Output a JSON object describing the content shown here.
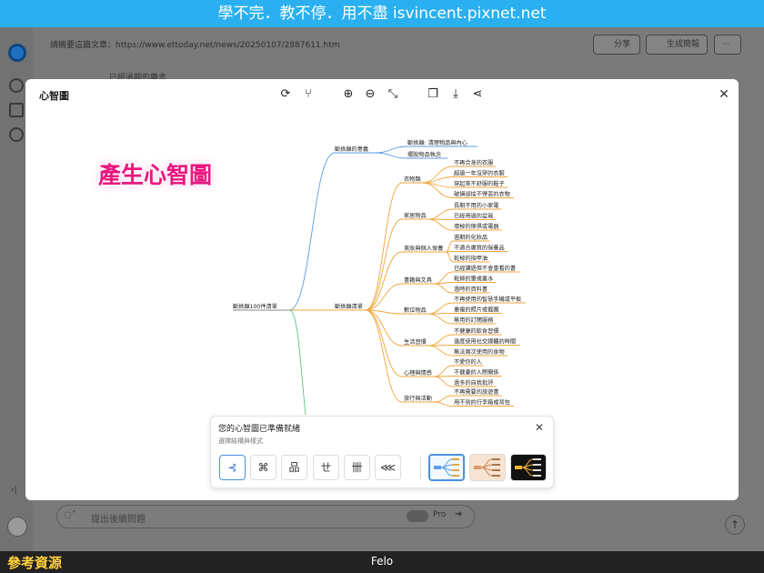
{
  "banner": {
    "text": "學不完．教不停．用不盡 isvincent.pixnet.net"
  },
  "background": {
    "url_label": "請摘要這篇文章：https://www.ettoday.net/news/20250107/2887611.htm",
    "share_label": "分享",
    "generate_label": "生成簡報",
    "more_label": "···",
    "under_text": "已經過期的藥盒",
    "chat_placeholder": "提出後續問題",
    "pro_label": "Pro",
    "send_icon": "arrow-right-icon"
  },
  "modal": {
    "title": "心智圖",
    "toolbar_icons": [
      "refresh-icon",
      "branch-icon",
      "zoom-in-icon",
      "zoom-out-icon",
      "fit-screen-icon",
      "copy-icon",
      "download-icon",
      "share-icon"
    ]
  },
  "overlay": {
    "text": "產生心智圖"
  },
  "mindmap": {
    "root": "斷捨離100件清單",
    "branches": [
      {
        "label": "斷捨離的意義",
        "children": [
          {
            "label": "斷捨離: 清理物品與內心",
            "children": []
          },
          {
            "label": "擺脫物品執念",
            "children": []
          }
        ]
      },
      {
        "label": "斷捨離清單",
        "children": [
          {
            "label": "衣物類",
            "children": [
              "不再合身的衣服",
              "超過一年沒穿的衣服",
              "穿起來不舒服的鞋子",
              "破損卻捨不得丟的衣物"
            ]
          },
          {
            "label": "家居物品",
            "children": [
              "長期不用的小家電",
              "已經用過的盆栽",
              "壞掉的傢俱或電器"
            ]
          },
          {
            "label": "美妝與個人保養",
            "children": [
              "過期的化妝品",
              "不適合膚質的保養品",
              "乾掉的指甲油"
            ]
          },
          {
            "label": "書籍與文具",
            "children": [
              "已經讀過但不會重看的書",
              "乾掉的筆或墨水",
              "過時的資料書"
            ]
          },
          {
            "label": "數位物品",
            "children": [
              "不再使用的智慧手機或平板",
              "重複的照片或截圖",
              "無用的訂閱服務"
            ]
          },
          {
            "label": "生活習慣",
            "children": [
              "不健康的飲食習慣",
              "過度使用社交媒體的時間",
              "無法兩次使用的食物"
            ]
          },
          {
            "label": "心理與情感",
            "children": [
              "不愛你的人",
              "不健康的人際關係",
              "過多的自我批評"
            ]
          },
          {
            "label": "旅行與活動",
            "children": [
              "不再需要的旅遊書",
              "用不到的行李箱或背包"
            ]
          }
        ]
      }
    ]
  },
  "panel": {
    "title": "您的心智圖已準備就緒",
    "subtitle": "選擇結構與樣式",
    "layouts": [
      "⊰",
      "⌘",
      "品",
      "ㄝ",
      "卌",
      "⋘"
    ],
    "themes": [
      "light-blue",
      "peach",
      "dark"
    ]
  },
  "footer": {
    "left": "參考資源",
    "center": "Felo"
  }
}
